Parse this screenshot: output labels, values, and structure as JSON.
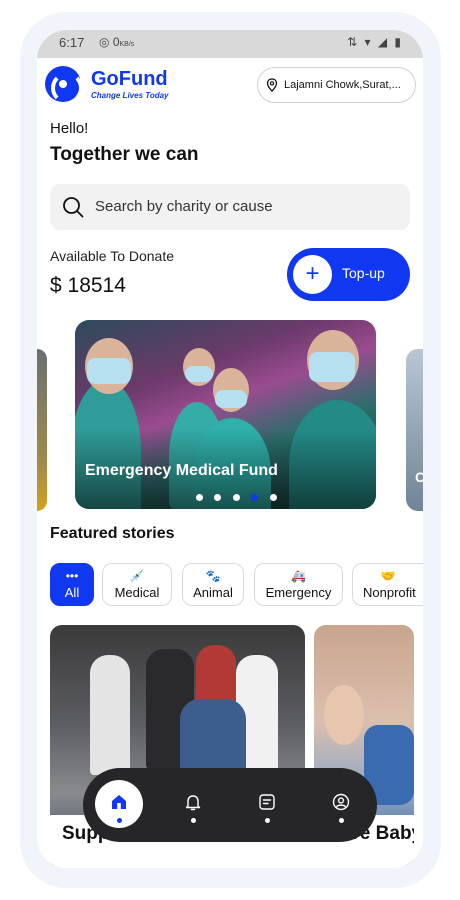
{
  "status_bar": {
    "time": "6:17",
    "data_speed": "0",
    "data_unit": "KB/s",
    "network": "Wi-Fi"
  },
  "header": {
    "brand": "GoFund",
    "tagline": "Change Lives Today",
    "location": "Lajamni Chowk,Surat,..."
  },
  "greeting": {
    "hello": "Hello!",
    "headline": "Together we can"
  },
  "search": {
    "placeholder": "Search by charity or cause"
  },
  "wallet": {
    "label": "Available To Donate",
    "amount": "$ 18514",
    "topup_label": "Top-up"
  },
  "carousel": {
    "title": "Emergency Medical Fund",
    "right_card_letter": "C",
    "dot_count": 5,
    "active_dot": 4
  },
  "featured": {
    "title": "Featured stories",
    "categories": [
      {
        "label": "All",
        "icon": "dots-icon",
        "active": true
      },
      {
        "label": "Medical",
        "icon": "syringe-icon",
        "active": false
      },
      {
        "label": "Animal",
        "icon": "paw-icon",
        "active": false
      },
      {
        "label": "Emergency",
        "icon": "ambulance-icon",
        "active": false
      },
      {
        "label": "Nonprofit",
        "icon": "handshake-icon",
        "active": false
      }
    ],
    "stories": [
      {
        "title": "Support Amal Babies Of In"
      },
      {
        "title": "Save Baby"
      }
    ]
  },
  "bottom_nav": {
    "items": [
      "home",
      "notifications",
      "notes",
      "profile"
    ],
    "active": "home"
  },
  "colors": {
    "brand_blue": "#1038f0",
    "nav_dark": "#262629"
  }
}
